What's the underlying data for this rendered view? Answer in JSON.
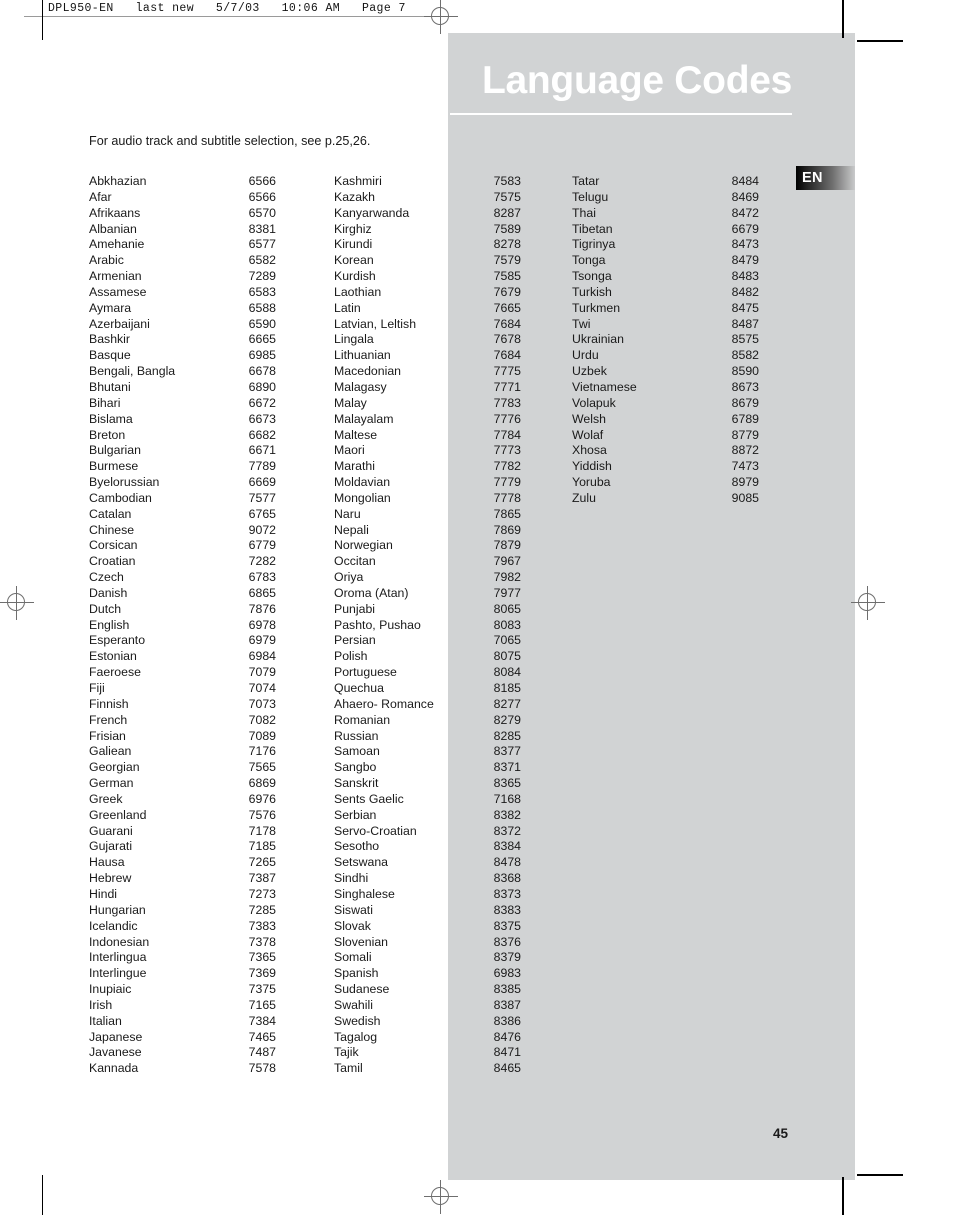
{
  "running_head": "DPL950-EN   last new   5/7/03   10:06 AM   Page 7",
  "title": "Language Codes",
  "language_badge": "EN",
  "intro": "For audio track and subtitle selection, see p.25,26.",
  "page_number": "45",
  "colors": {
    "panel_gray": "#d1d3d4",
    "title_white": "#ffffff",
    "text_black": "#1a1a1a",
    "badge_gradient_start": "#000000",
    "badge_gradient_end": "#c9cacb"
  },
  "columns": [
    {
      "id": "column-1",
      "entries": [
        {
          "language": "Abkhazian",
          "code": "6566"
        },
        {
          "language": "Afar",
          "code": "6566"
        },
        {
          "language": "Afrikaans",
          "code": "6570"
        },
        {
          "language": "Albanian",
          "code": "8381"
        },
        {
          "language": "Amehanie",
          "code": "6577"
        },
        {
          "language": "Arabic",
          "code": "6582"
        },
        {
          "language": "Armenian",
          "code": "7289"
        },
        {
          "language": "Assamese",
          "code": "6583"
        },
        {
          "language": "Aymara",
          "code": "6588"
        },
        {
          "language": "Azerbaijani",
          "code": "6590"
        },
        {
          "language": "Bashkir",
          "code": "6665"
        },
        {
          "language": "Basque",
          "code": "6985"
        },
        {
          "language": "Bengali, Bangla",
          "code": "6678"
        },
        {
          "language": "Bhutani",
          "code": "6890"
        },
        {
          "language": "Bihari",
          "code": "6672"
        },
        {
          "language": "Bislama",
          "code": "6673"
        },
        {
          "language": "Breton",
          "code": "6682"
        },
        {
          "language": "Bulgarian",
          "code": "6671"
        },
        {
          "language": "Burmese",
          "code": "7789"
        },
        {
          "language": "Byelorussian",
          "code": "6669"
        },
        {
          "language": "Cambodian",
          "code": "7577"
        },
        {
          "language": "Catalan",
          "code": "6765"
        },
        {
          "language": "Chinese",
          "code": "9072"
        },
        {
          "language": "Corsican",
          "code": "6779"
        },
        {
          "language": "Croatian",
          "code": "7282"
        },
        {
          "language": "Czech",
          "code": "6783"
        },
        {
          "language": "Danish",
          "code": "6865"
        },
        {
          "language": "Dutch",
          "code": "7876"
        },
        {
          "language": "English",
          "code": "6978"
        },
        {
          "language": "Esperanto",
          "code": "6979"
        },
        {
          "language": "Estonian",
          "code": "6984"
        },
        {
          "language": "Faeroese",
          "code": "7079"
        },
        {
          "language": "Fiji",
          "code": "7074"
        },
        {
          "language": "Finnish",
          "code": "7073"
        },
        {
          "language": "French",
          "code": "7082"
        },
        {
          "language": "Frisian",
          "code": "7089"
        },
        {
          "language": "Galiean",
          "code": "7176"
        },
        {
          "language": "Georgian",
          "code": "7565"
        },
        {
          "language": "German",
          "code": "6869"
        },
        {
          "language": "Greek",
          "code": "6976"
        },
        {
          "language": "Greenland",
          "code": "7576"
        },
        {
          "language": "Guarani",
          "code": "7178"
        },
        {
          "language": "Gujarati",
          "code": "7185"
        },
        {
          "language": "Hausa",
          "code": "7265"
        },
        {
          "language": "Hebrew",
          "code": "7387"
        },
        {
          "language": "Hindi",
          "code": "7273"
        },
        {
          "language": "Hungarian",
          "code": "7285"
        },
        {
          "language": "Icelandic",
          "code": "7383"
        },
        {
          "language": "Indonesian",
          "code": "7378"
        },
        {
          "language": "Interlingua",
          "code": "7365"
        },
        {
          "language": "Interlingue",
          "code": "7369"
        },
        {
          "language": "Inupiaic",
          "code": "7375"
        },
        {
          "language": "Irish",
          "code": "7165"
        },
        {
          "language": "Italian",
          "code": "7384"
        },
        {
          "language": "Japanese",
          "code": "7465"
        },
        {
          "language": "Javanese",
          "code": "7487"
        },
        {
          "language": "Kannada",
          "code": "7578"
        }
      ]
    },
    {
      "id": "column-2",
      "entries": [
        {
          "language": "Kashmiri",
          "code": "7583"
        },
        {
          "language": "Kazakh",
          "code": "7575"
        },
        {
          "language": "Kanyarwanda",
          "code": "8287"
        },
        {
          "language": "Kirghiz",
          "code": "7589"
        },
        {
          "language": "Kirundi",
          "code": "8278"
        },
        {
          "language": "Korean",
          "code": "7579"
        },
        {
          "language": "Kurdish",
          "code": "7585"
        },
        {
          "language": "Laothian",
          "code": "7679"
        },
        {
          "language": "Latin",
          "code": "7665"
        },
        {
          "language": "Latvian, Leltish",
          "code": "7684"
        },
        {
          "language": "Lingala",
          "code": "7678"
        },
        {
          "language": "Lithuanian",
          "code": "7684"
        },
        {
          "language": "Macedonian",
          "code": "7775"
        },
        {
          "language": "Malagasy",
          "code": "7771"
        },
        {
          "language": "Malay",
          "code": "7783"
        },
        {
          "language": "Malayalam",
          "code": "7776"
        },
        {
          "language": "Maltese",
          "code": "7784"
        },
        {
          "language": "Maori",
          "code": "7773"
        },
        {
          "language": "Marathi",
          "code": "7782"
        },
        {
          "language": "Moldavian",
          "code": "7779"
        },
        {
          "language": "Mongolian",
          "code": "7778"
        },
        {
          "language": "Naru",
          "code": "7865"
        },
        {
          "language": "Nepali",
          "code": "7869"
        },
        {
          "language": "Norwegian",
          "code": "7879"
        },
        {
          "language": "Occitan",
          "code": "7967"
        },
        {
          "language": "Oriya",
          "code": "7982"
        },
        {
          "language": "Oroma (Atan)",
          "code": "7977"
        },
        {
          "language": "Punjabi",
          "code": "8065"
        },
        {
          "language": "Pashto, Pushao",
          "code": "8083"
        },
        {
          "language": "Persian",
          "code": "7065"
        },
        {
          "language": "Polish",
          "code": "8075"
        },
        {
          "language": "Portuguese",
          "code": "8084"
        },
        {
          "language": "Quechua",
          "code": "8185"
        },
        {
          "language": "Ahaero- Romance",
          "code": "8277"
        },
        {
          "language": "Romanian",
          "code": "8279"
        },
        {
          "language": "Russian",
          "code": "8285"
        },
        {
          "language": "Samoan",
          "code": "8377"
        },
        {
          "language": "Sangbo",
          "code": "8371"
        },
        {
          "language": "Sanskrit",
          "code": "8365"
        },
        {
          "language": "Sents Gaelic",
          "code": "7168"
        },
        {
          "language": "Serbian",
          "code": "8382"
        },
        {
          "language": "Servo-Croatian",
          "code": "8372"
        },
        {
          "language": "Sesotho",
          "code": "8384"
        },
        {
          "language": "Setswana",
          "code": "8478"
        },
        {
          "language": "Sindhi",
          "code": "8368"
        },
        {
          "language": "Singhalese",
          "code": "8373"
        },
        {
          "language": "Siswati",
          "code": "8383"
        },
        {
          "language": "Slovak",
          "code": "8375"
        },
        {
          "language": "Slovenian",
          "code": "8376"
        },
        {
          "language": "Somali",
          "code": "8379"
        },
        {
          "language": "Spanish",
          "code": "6983"
        },
        {
          "language": "Sudanese",
          "code": "8385"
        },
        {
          "language": "Swahili",
          "code": "8387"
        },
        {
          "language": "Swedish",
          "code": "8386"
        },
        {
          "language": "Tagalog",
          "code": "8476"
        },
        {
          "language": "Tajik",
          "code": "8471"
        },
        {
          "language": "Tamil",
          "code": "8465"
        }
      ]
    },
    {
      "id": "column-3",
      "entries": [
        {
          "language": "Tatar",
          "code": "8484"
        },
        {
          "language": "Telugu",
          "code": "8469"
        },
        {
          "language": "Thai",
          "code": "8472"
        },
        {
          "language": "Tibetan",
          "code": "6679"
        },
        {
          "language": "Tigrinya",
          "code": "8473"
        },
        {
          "language": "Tonga",
          "code": "8479"
        },
        {
          "language": "Tsonga",
          "code": "8483"
        },
        {
          "language": "Turkish",
          "code": "8482"
        },
        {
          "language": "Turkmen",
          "code": "8475"
        },
        {
          "language": "Twi",
          "code": "8487"
        },
        {
          "language": "Ukrainian",
          "code": "8575"
        },
        {
          "language": "Urdu",
          "code": "8582"
        },
        {
          "language": "Uzbek",
          "code": "8590"
        },
        {
          "language": "Vietnamese",
          "code": "8673"
        },
        {
          "language": "Volapuk",
          "code": "8679"
        },
        {
          "language": "Welsh",
          "code": "6789"
        },
        {
          "language": "Wolaf",
          "code": "8779"
        },
        {
          "language": "Xhosa",
          "code": "8872"
        },
        {
          "language": "Yiddish",
          "code": "7473"
        },
        {
          "language": "Yoruba",
          "code": "8979"
        },
        {
          "language": "Zulu",
          "code": "9085"
        }
      ]
    }
  ]
}
